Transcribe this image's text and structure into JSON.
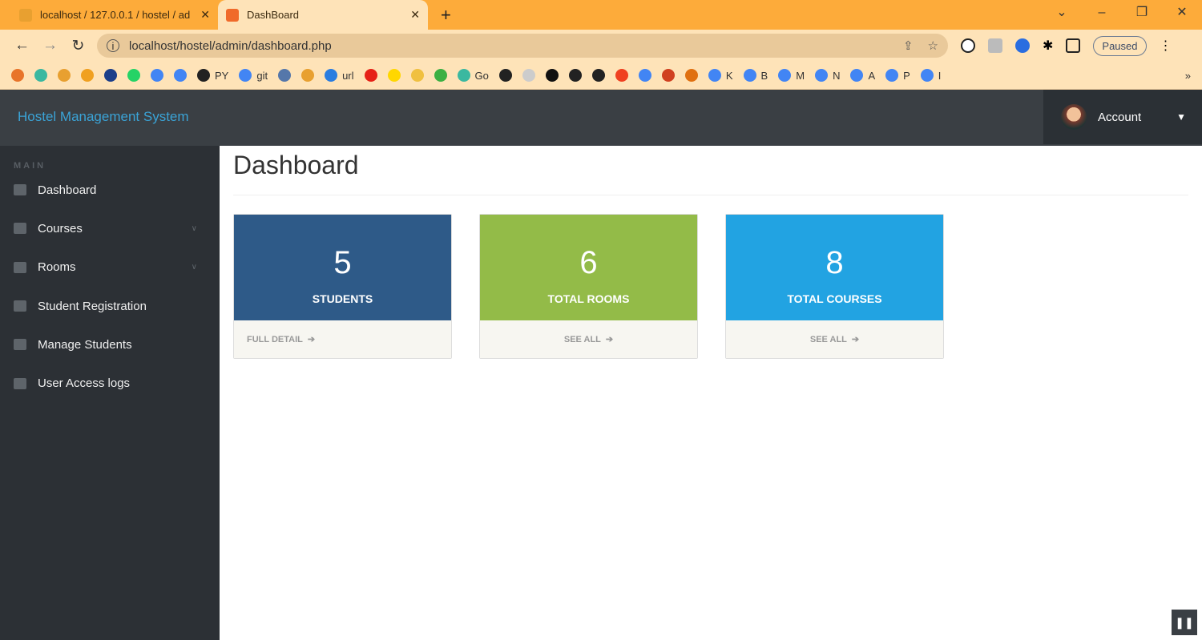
{
  "browser": {
    "tabs": [
      {
        "title": "localhost / 127.0.0.1 / hostel / ad",
        "active": false
      },
      {
        "title": "DashBoard",
        "active": true
      }
    ],
    "url": "localhost/hostel/admin/dashboard.php",
    "profile_status": "Paused",
    "bookmarks": [
      "",
      "",
      "",
      "",
      "",
      "",
      "",
      "",
      "PY",
      "git",
      "",
      "",
      "url",
      "",
      "",
      "",
      "",
      "Go",
      "",
      "",
      "",
      "",
      "",
      "",
      "",
      "",
      "",
      "K",
      "B",
      "M",
      "N",
      "A",
      "P",
      "I"
    ],
    "overflow": "»"
  },
  "header": {
    "brand": "Hostel Management System",
    "account_label": "Account"
  },
  "sidebar": {
    "section": "MAIN",
    "items": [
      {
        "label": "Dashboard",
        "icon": "dashboard-icon"
      },
      {
        "label": "Courses",
        "icon": "copy-icon",
        "expandable": true
      },
      {
        "label": "Rooms",
        "icon": "desktop-icon",
        "expandable": true
      },
      {
        "label": "Student Registration",
        "icon": "user-icon"
      },
      {
        "label": "Manage Students",
        "icon": "users-icon"
      },
      {
        "label": "User Access logs",
        "icon": "file-icon"
      }
    ]
  },
  "main": {
    "title": "Dashboard",
    "cards": [
      {
        "value": "5",
        "label": "STUDENTS",
        "link": "FULL DETAIL",
        "color": "#2e5a88"
      },
      {
        "value": "6",
        "label": "TOTAL ROOMS",
        "link": "SEE ALL",
        "color": "#93bb48"
      },
      {
        "value": "8",
        "label": "TOTAL COURSES",
        "link": "SEE ALL",
        "color": "#22a3e2"
      }
    ]
  }
}
